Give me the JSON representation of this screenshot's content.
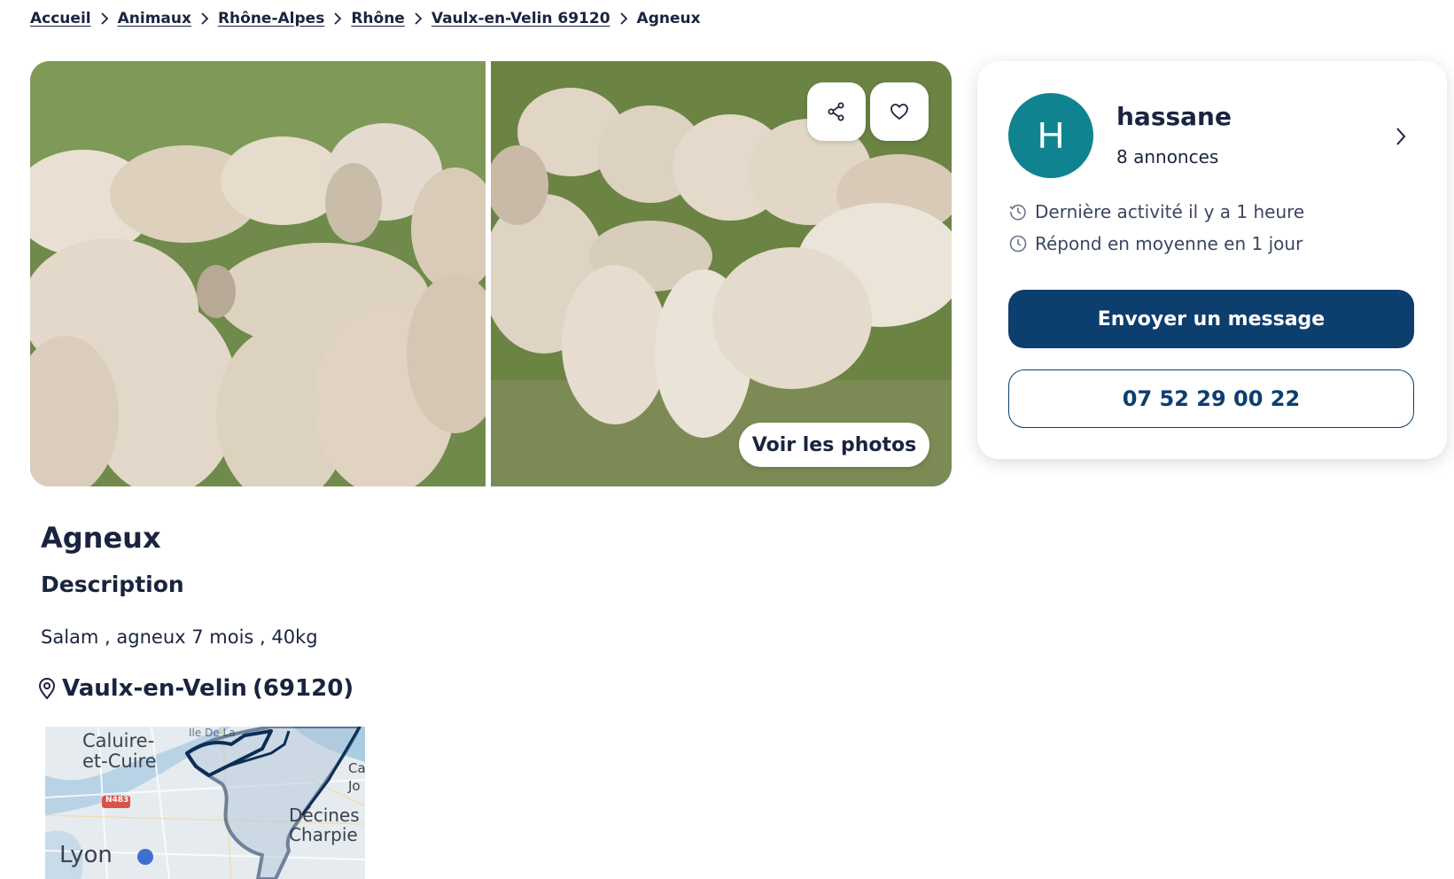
{
  "breadcrumb": {
    "items": [
      {
        "label": "Accueil"
      },
      {
        "label": "Animaux"
      },
      {
        "label": "Rhône-Alpes"
      },
      {
        "label": "Rhône"
      },
      {
        "label": "Vaulx-en-Velin 69120"
      }
    ],
    "current": "Agneux"
  },
  "gallery": {
    "see_photos_label": "Voir les photos",
    "share_icon": "share-icon",
    "favorite_icon": "heart-icon"
  },
  "seller": {
    "avatar_initial": "H",
    "name": "hassane",
    "listings_count": "8 annonces",
    "last_activity": "Dernière activité il y a 1 heure",
    "response_time": "Répond en moyenne en 1 jour",
    "message_button": "Envoyer un message",
    "phone": "07 52 29 00 22",
    "avatar_color": "#0f8490",
    "primary_color": "#0c3e6e"
  },
  "ad": {
    "title": "Agneux",
    "description_heading": "Description",
    "description": "Salam , agneux 7 mois , 40kg",
    "location_city": "Vaulx-en-Velin",
    "location_zip": "(69120)"
  },
  "map": {
    "labels": {
      "caluire_1": "Caluire-",
      "caluire_2": "et-Cuire",
      "ile": "Ile De La",
      "road": "N483",
      "lyon": "Lyon",
      "decines_1": "Décines",
      "decines_2": "Charpie",
      "ca": "Ca",
      "jo": "Jo"
    }
  }
}
